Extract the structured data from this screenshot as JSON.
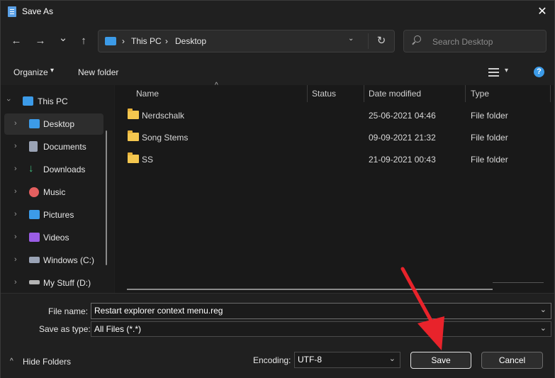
{
  "window": {
    "title": "Save As",
    "close_glyph": "✕"
  },
  "nav": {
    "back_glyph": "←",
    "forward_glyph": "→",
    "recent_glyph": "⌄",
    "up_glyph": "↑",
    "breadcrumbs": [
      "This PC",
      "Desktop"
    ],
    "crumb_sep": "›",
    "refresh_glyph": "↻",
    "search_placeholder": "Search Desktop"
  },
  "toolbar": {
    "organize": "Organize",
    "organize_caret": "▾",
    "new_folder": "New folder",
    "view_caret": "▾",
    "help": "?"
  },
  "sidebar": {
    "items": [
      {
        "label": "This PC",
        "icon": "monitor-icon",
        "color": "#3c9be8"
      },
      {
        "label": "Desktop",
        "icon": "desktop-icon",
        "color": "#3c9be8"
      },
      {
        "label": "Documents",
        "icon": "document-icon",
        "color": "#9aa3b5"
      },
      {
        "label": "Downloads",
        "icon": "download-icon",
        "color": "#3fbf7f"
      },
      {
        "label": "Music",
        "icon": "music-icon",
        "color": "#e45f5f"
      },
      {
        "label": "Pictures",
        "icon": "pictures-icon",
        "color": "#3c9be8"
      },
      {
        "label": "Videos",
        "icon": "videos-icon",
        "color": "#9b5de5"
      },
      {
        "label": "Windows (C:)",
        "icon": "drive-icon",
        "color": "#9aa3b5"
      },
      {
        "label": "My Stuff (D:)",
        "icon": "drive-icon",
        "color": "#b5b5b5"
      }
    ],
    "selected": "Desktop",
    "chev": "›"
  },
  "list": {
    "columns": [
      "Name",
      "Status",
      "Date modified",
      "Type"
    ],
    "sort_glyph": "^",
    "rows": [
      {
        "name": "Nerdschalk",
        "status": "",
        "date": "25-06-2021 04:46",
        "type": "File folder"
      },
      {
        "name": "Song Stems",
        "status": "",
        "date": "09-09-2021 21:32",
        "type": "File folder"
      },
      {
        "name": "SS",
        "status": "",
        "date": "21-09-2021 00:43",
        "type": "File folder"
      }
    ]
  },
  "form": {
    "file_name_label": "File name:",
    "file_name_value": "Restart explorer context menu.reg",
    "save_type_label": "Save as type:",
    "save_type_value": "All Files  (*.*)",
    "dd_glyph": "⌄",
    "hide_folders": "Hide Folders",
    "hide_caret": "^",
    "encoding_label": "Encoding:",
    "encoding_value": "UTF-8",
    "save": "Save",
    "cancel": "Cancel"
  },
  "colors": {
    "accent": "#3c9be8",
    "folder": "#f4c74f",
    "annotation_arrow": "#e8232b"
  }
}
